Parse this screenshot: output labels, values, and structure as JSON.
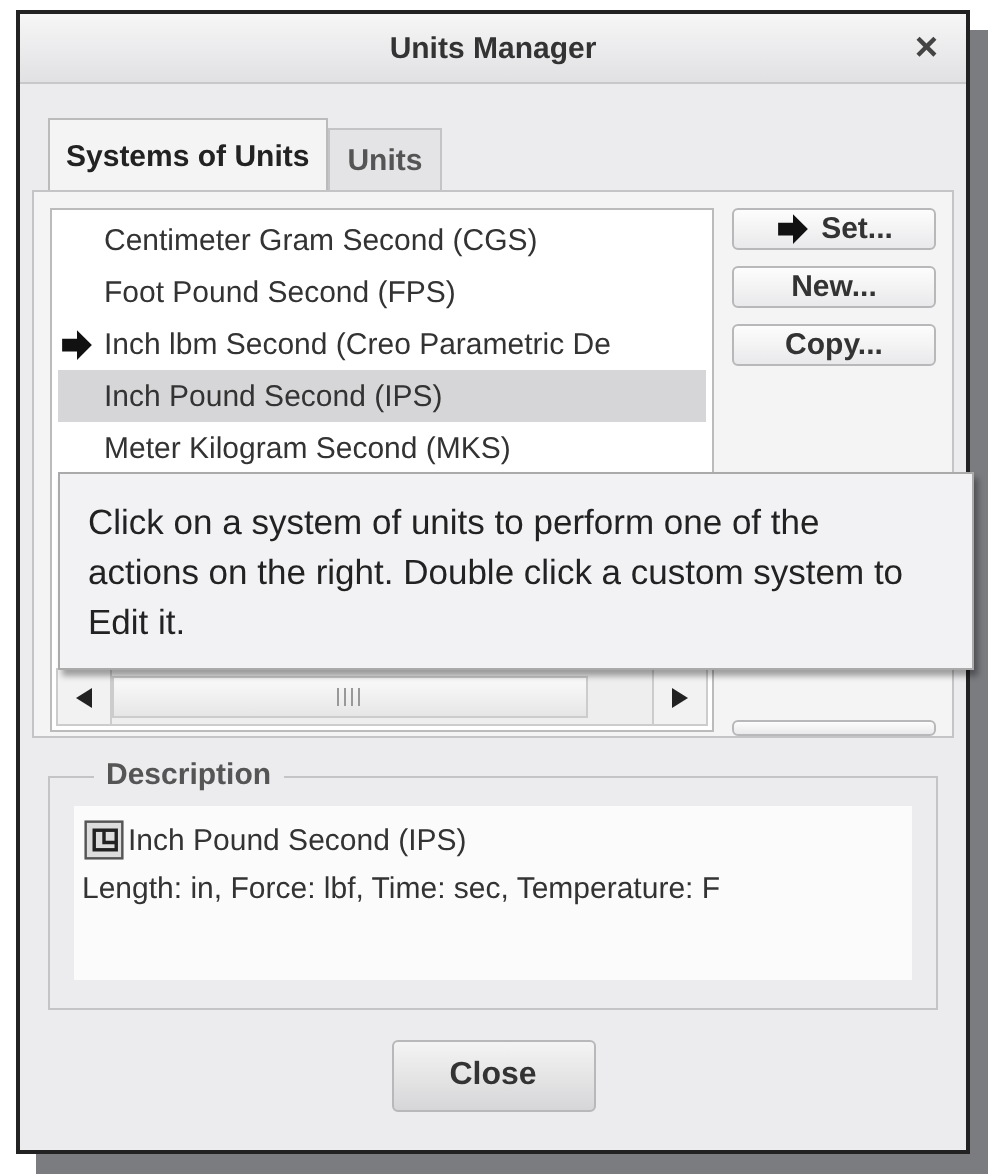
{
  "window": {
    "title": "Units Manager",
    "close": "×"
  },
  "tabs": [
    {
      "label": "Systems of Units",
      "selected": true
    },
    {
      "label": "Units",
      "selected": false
    }
  ],
  "systems": [
    {
      "label": "Centimeter Gram Second (CGS)",
      "selected": false,
      "current": false
    },
    {
      "label": "Foot Pound Second (FPS)",
      "selected": false,
      "current": false
    },
    {
      "label": "Inch lbm Second (Creo Parametric De",
      "selected": false,
      "current": true
    },
    {
      "label": "Inch Pound Second (IPS)",
      "selected": true,
      "current": false
    },
    {
      "label": "Meter Kilogram Second (MKS)",
      "selected": false,
      "current": false
    }
  ],
  "buttons": [
    {
      "label": "Set...",
      "arrow": true
    },
    {
      "label": "New...",
      "arrow": false
    },
    {
      "label": "Copy...",
      "arrow": false
    }
  ],
  "tooltip": "Click on a system of units to perform one of the actions on the right. Double click a custom system to Edit it.",
  "description": {
    "legend": "Description",
    "name": "Inch Pound Second (IPS)",
    "details": "Length: in, Force: lbf, Time: sec, Temperature: F"
  },
  "close_button": "Close"
}
